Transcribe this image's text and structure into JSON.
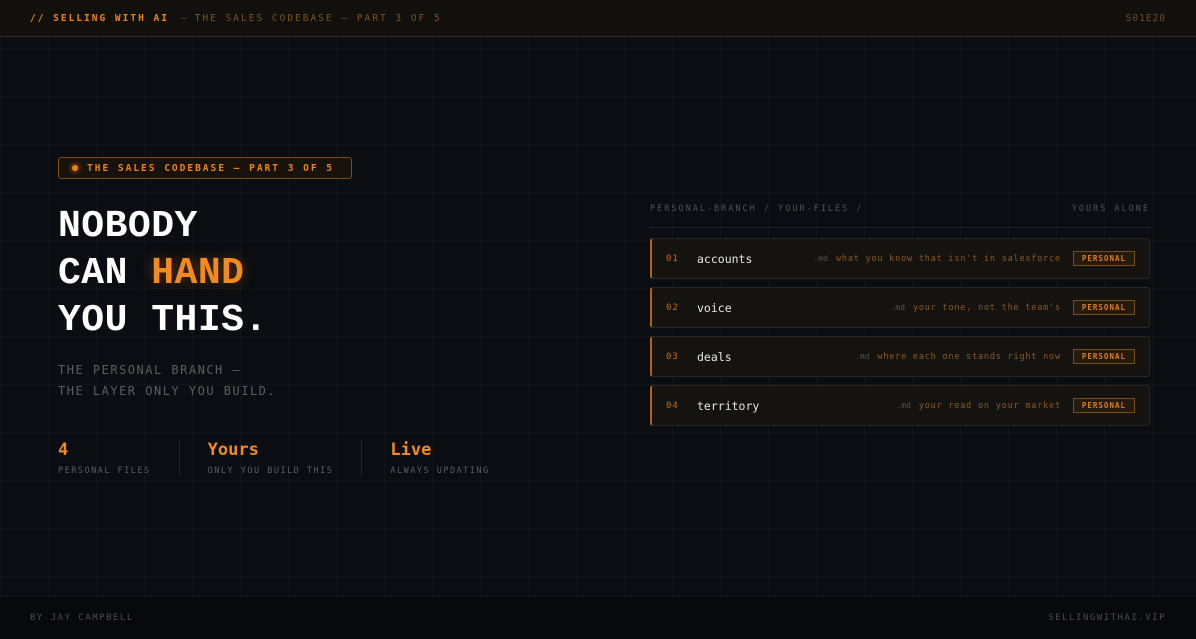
{
  "topbar": {
    "brand": "// SELLING WITH AI",
    "separator": "—",
    "subtitle": "THE SALES CODEBASE — PART 3 OF 5",
    "episode": "S01E20"
  },
  "tag": {
    "label": "THE SALES CODEBASE — PART 3 OF 5"
  },
  "headline": {
    "line1": "NOBODY",
    "line2_pre": "CAN ",
    "line2_highlight": "HAND",
    "line3": "YOU THIS."
  },
  "subtext": {
    "line1": "THE PERSONAL BRANCH —",
    "line2": "THE LAYER ONLY YOU BUILD."
  },
  "stats": [
    {
      "value": "4",
      "label": "PERSONAL FILES"
    },
    {
      "value": "Yours",
      "label": "ONLY YOU BUILD THIS"
    },
    {
      "value": "Live",
      "label": "ALWAYS UPDATING"
    }
  ],
  "panel": {
    "path": "PERSONAL-BRANCH / YOUR-FILES /",
    "note": "YOURS ALONE",
    "files": [
      {
        "index": "01",
        "name": "accounts",
        "ext": ".md",
        "description": "what you know that isn't in salesforce",
        "badge": "PERSONAL"
      },
      {
        "index": "02",
        "name": "voice",
        "ext": ".md",
        "description": "your tone, not the team's",
        "badge": "PERSONAL"
      },
      {
        "index": "03",
        "name": "deals",
        "ext": ".md",
        "description": "where each one stands right now",
        "badge": "PERSONAL"
      },
      {
        "index": "04",
        "name": "territory",
        "ext": ".md",
        "description": "your read on your market",
        "badge": "PERSONAL"
      }
    ]
  },
  "footer": {
    "author": "BY JAY CAMPBELL",
    "site": "SELLINGWITHAI.VIP"
  },
  "colors": {
    "accent": "#f0820f",
    "background": "#0a0d12",
    "text": "#ffffff"
  }
}
